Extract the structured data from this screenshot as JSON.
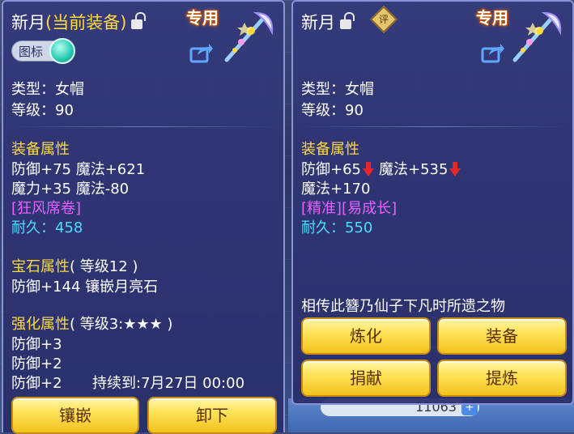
{
  "left": {
    "title": "新月",
    "title_sub": "(当前装备)",
    "exclusive": "专用",
    "icon_toggle_label": "图标",
    "type_line": "类型：女帽",
    "level_line": "等级：90",
    "equip_attr_header": "装备属性",
    "attr_line1": "防御+75 魔法+621",
    "attr_line2": "魔力+35 魔法-80",
    "special": "[狂风席卷]",
    "durability_label": "耐久：",
    "durability_value": "458",
    "gem_header": "宝石属性",
    "gem_level": "( 等级12 )",
    "gem_line": "防御+144 镶嵌月亮石",
    "strengthen_header": "强化属性",
    "strengthen_level": "( 等级3:★★★ )",
    "str_line1": "防御+3",
    "str_line2": "防御+2",
    "str_line3": "防御+2",
    "duration": "持续到:7月27日 00:00",
    "buttons": [
      "镶嵌",
      "卸下"
    ]
  },
  "right": {
    "title": "新月",
    "rating_icon": "评",
    "exclusive": "专用",
    "type_line": "类型：女帽",
    "level_line": "等级：90",
    "equip_attr_header": "装备属性",
    "attr_def": "防御+65",
    "attr_magic": "魔法+535",
    "attr_line2": "魔法+170",
    "special": "[精准][易成长]",
    "durability_label": "耐久：",
    "durability_value": "550",
    "description": "相传此簪乃仙子下凡时所遗之物",
    "buttons": [
      "炼化",
      "装备",
      "捐献",
      "提炼"
    ]
  },
  "currency": {
    "value": "11063",
    "plus": "+"
  },
  "colors": {
    "yellow": "#ffd93a",
    "magenta": "#e760ff",
    "cyan": "#4fdcff",
    "button": "#ffe35a"
  }
}
